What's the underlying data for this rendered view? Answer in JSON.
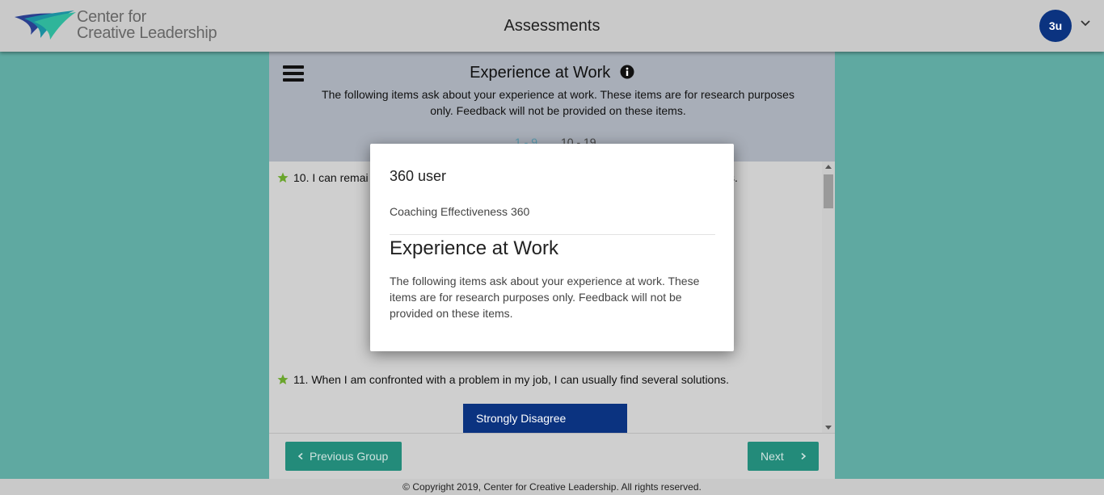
{
  "header": {
    "logo_line1": "Center for",
    "logo_line2": "Creative Leadership",
    "title": "Assessments",
    "avatar_initials": "3u",
    "avatar_color": "#0b3380"
  },
  "section": {
    "title": "Experience at Work",
    "description": "The following items ask about your experience at work. These items are for research purposes only. Feedback will not be provided on these items.",
    "tabs": [
      {
        "label": "1 - 9",
        "active": true
      },
      {
        "label": "10 - 19",
        "active": false
      }
    ]
  },
  "questions": [
    {
      "number": "10.",
      "text_visible_start": "I can remai",
      "text_visible_end": "s."
    },
    {
      "number": "11.",
      "text": "When I am confronted with a problem in my job, I can usually find several solutions."
    }
  ],
  "choice": {
    "label": "Strongly Disagree"
  },
  "nav": {
    "previous_label": "Previous Group",
    "next_label": "Next"
  },
  "modal": {
    "user": "360 user",
    "assessment": "Coaching Effectiveness 360",
    "title": "Experience at Work",
    "description": "The following items ask about your experience at work. These items are for research purposes only. Feedback will not be provided on these items."
  },
  "footer": {
    "copyright": "© Copyright 2019, Center for Creative Leadership. All rights reserved."
  },
  "colors": {
    "background_teal": "#5fa9a1",
    "button_teal": "#238b7a",
    "brand_blue": "#0b3380",
    "star_green": "#6aa52c"
  },
  "icons": [
    "logo-mark",
    "user-caret-down-icon",
    "hamburger-menu-icon",
    "info-icon",
    "star-icon",
    "chevron-left-icon",
    "chevron-right-icon"
  ]
}
